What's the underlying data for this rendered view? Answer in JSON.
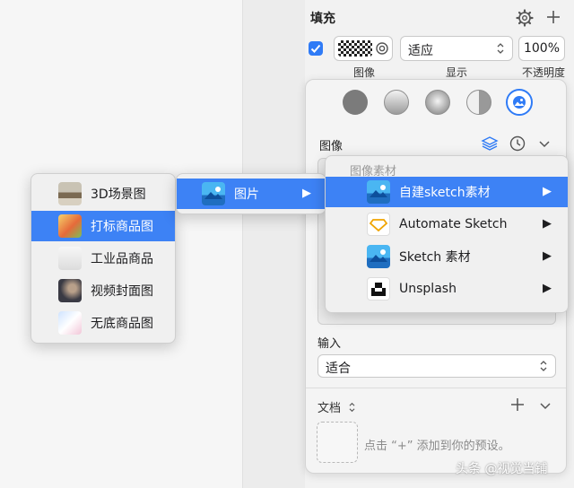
{
  "fill": {
    "title": "填充",
    "display_value": "适应",
    "opacity_value": "100%",
    "labels": {
      "image": "图像",
      "display": "显示",
      "opacity": "不透明度"
    }
  },
  "popover": {
    "image_label": "图像",
    "input_label": "输入",
    "input_value": "适合",
    "doc_label": "文档",
    "preset_hint": "点击 “+” 添加到你的预设。"
  },
  "menu1": {
    "items": [
      {
        "label": "3D场景图",
        "icon": "thumb-3d-scene"
      },
      {
        "label": "打标商品图",
        "icon": "thumb-tagged-product"
      },
      {
        "label": "工业品商品",
        "icon": "thumb-industrial"
      },
      {
        "label": "视频封面图",
        "icon": "thumb-video-cover"
      },
      {
        "label": "无底商品图",
        "icon": "thumb-no-bg"
      }
    ],
    "active_index": 1
  },
  "menu2": {
    "items": [
      {
        "label": "图片",
        "icon": "picture-icon"
      }
    ]
  },
  "menu3": {
    "header": "图像素材",
    "items": [
      {
        "label": "自建sketch素材",
        "icon": "picture-icon"
      },
      {
        "label": "Automate Sketch",
        "icon": "automate-sketch-icon"
      },
      {
        "label": "Sketch 素材",
        "icon": "sketch-assets-icon"
      },
      {
        "label": "Unsplash",
        "icon": "unsplash-icon"
      }
    ],
    "active_index": 0
  },
  "watermark": "头条 @视觉当铺",
  "colors": {
    "accent": "#3d82f5",
    "checkbox": "#2f7bf6"
  }
}
